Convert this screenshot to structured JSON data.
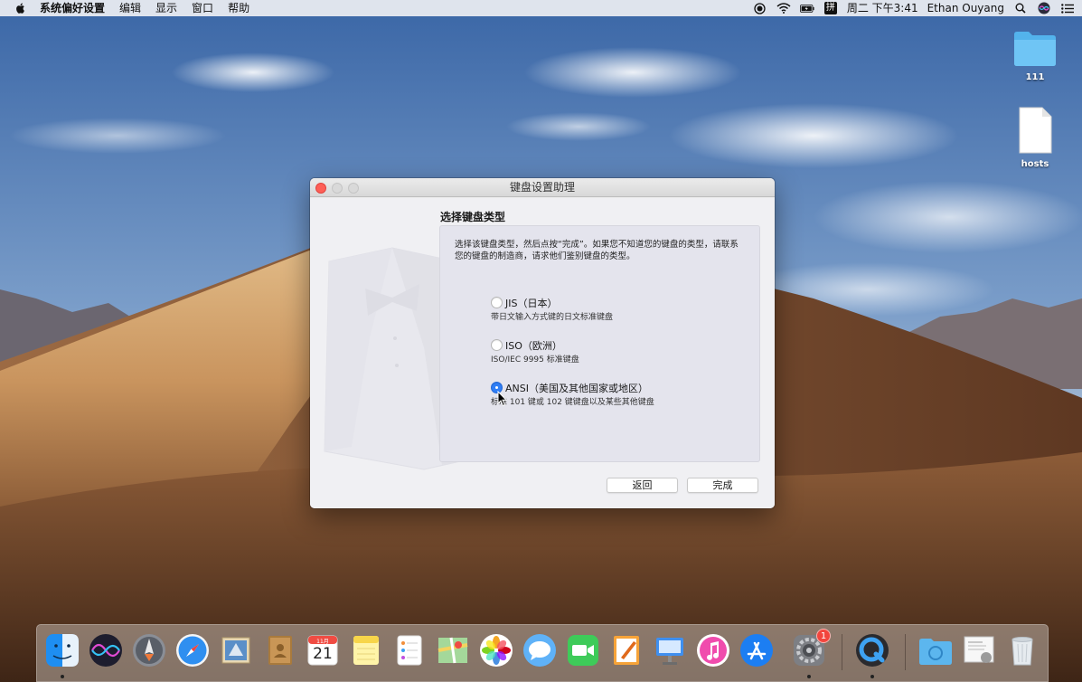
{
  "menubar": {
    "app_name": "系统偏好设置",
    "menus": [
      "编辑",
      "显示",
      "窗口",
      "帮助"
    ],
    "clock": "周二 下午3:41",
    "user": "Ethan Ouyang",
    "status_icons": [
      "screen-record-icon",
      "wifi-icon",
      "battery-icon",
      "input-method-icon"
    ],
    "input_method_label": "拼"
  },
  "desktop": {
    "icons": [
      {
        "name": "folder",
        "label": "111"
      },
      {
        "name": "file",
        "label": "hosts"
      }
    ]
  },
  "window": {
    "title": "键盘设置助理",
    "heading": "选择键盘类型",
    "description": "选择该键盘类型，然后点按“完成”。如果您不知道您的键盘的类型，请联系您的键盘的制造商，请求他们鉴别键盘的类型。",
    "options": [
      {
        "label": "JIS（日本）",
        "sub": "带日文输入方式键的日文标准键盘",
        "checked": false
      },
      {
        "label": "ISO（欧洲）",
        "sub": "ISO/IEC 9995 标准键盘",
        "checked": false
      },
      {
        "label": "ANSI（美国及其他国家或地区）",
        "sub": "标准 101 键或 102 键键盘以及某些其他键盘",
        "checked": true
      }
    ],
    "back_label": "返回",
    "done_label": "完成"
  },
  "dock": {
    "apps": [
      "finder-icon",
      "siri-icon",
      "launchpad-icon",
      "safari-icon",
      "mail-icon",
      "contacts-icon",
      "calendar-icon",
      "notes-icon",
      "reminders-icon",
      "maps-icon",
      "photos-icon",
      "messages-icon",
      "facetime-icon",
      "pages-icon",
      "keynote-icon",
      "itunes-icon",
      "app-store-icon",
      "system-preferences-icon",
      "quicktime-icon",
      "downloads-folder-icon",
      "preview-icon",
      "trash-icon"
    ],
    "calendar": {
      "month": "11月",
      "day": "21"
    },
    "system_preferences_badge": "1"
  }
}
